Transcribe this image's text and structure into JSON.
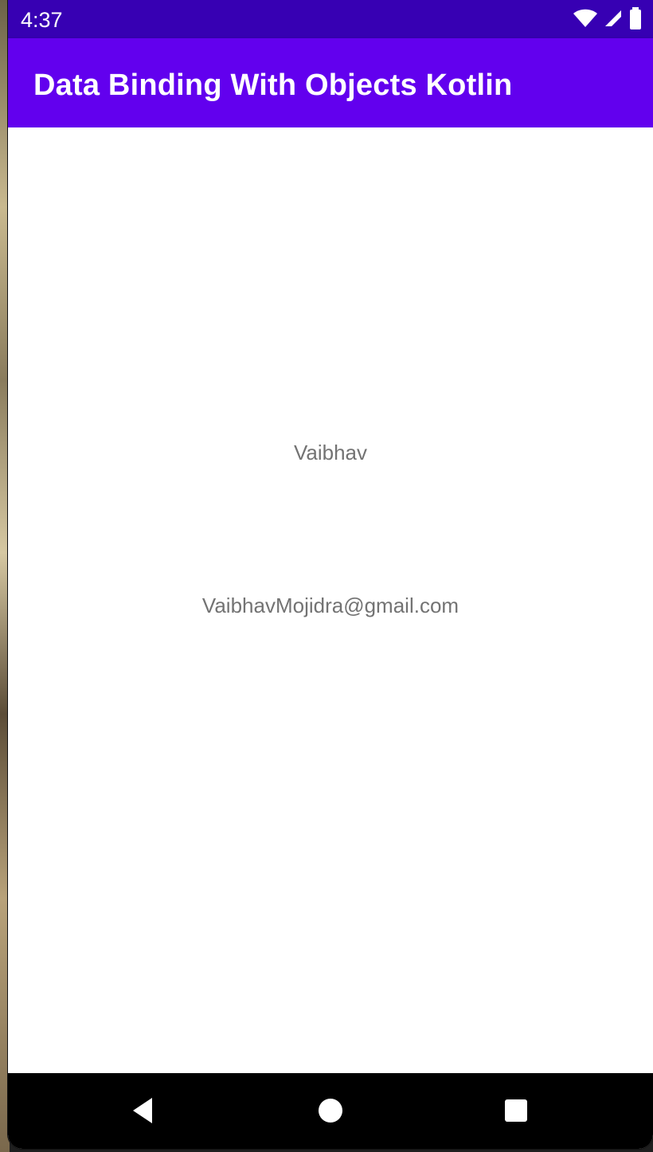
{
  "status_bar": {
    "time": "4:37",
    "icons": [
      "wifi-icon",
      "signal-icon",
      "battery-icon"
    ]
  },
  "app_bar": {
    "title": "Data Binding With Objects Kotlin"
  },
  "content": {
    "name": "Vaibhav",
    "email": "VaibhavMojidra@gmail.com"
  },
  "navigation": {
    "buttons": [
      "back-icon",
      "home-icon",
      "recent-apps-icon"
    ]
  },
  "colors": {
    "status_bar": "#3700b3",
    "app_bar": "#6200ee",
    "text": "#737373",
    "nav_bar": "#000000"
  }
}
